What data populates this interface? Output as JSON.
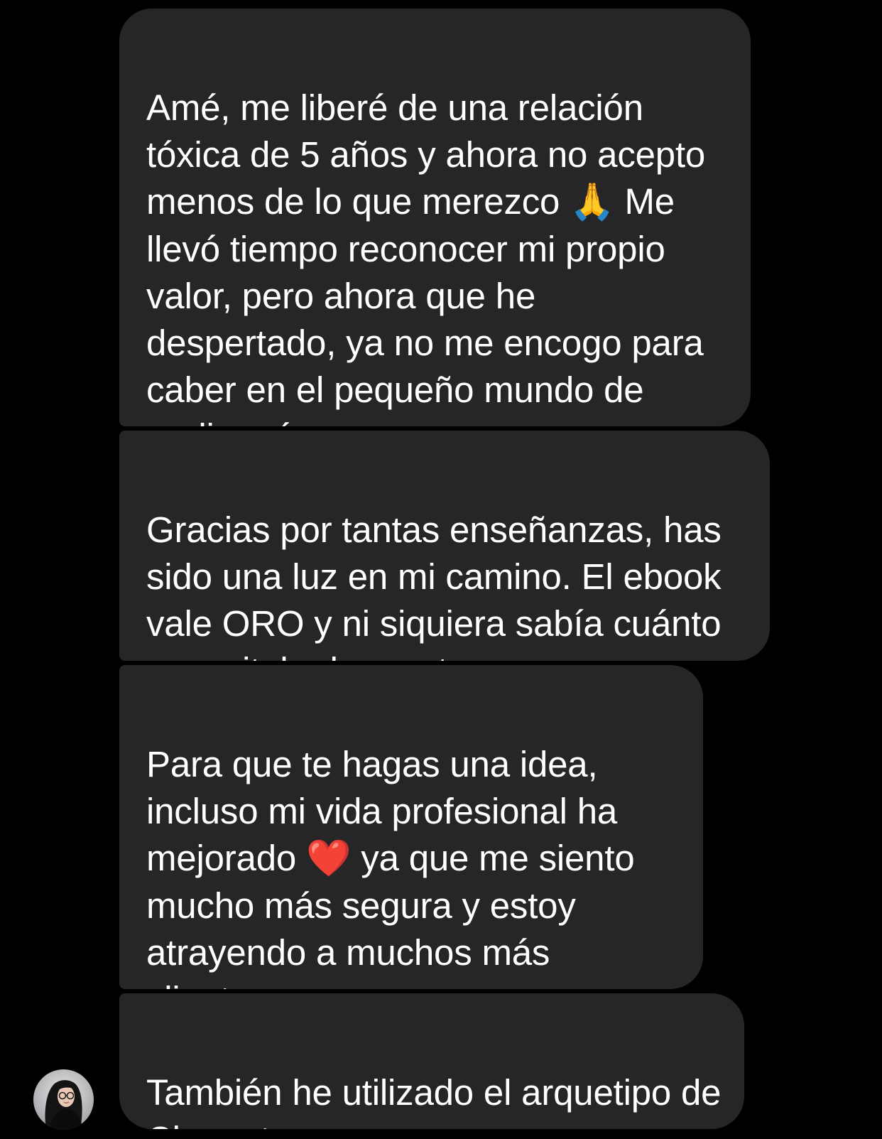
{
  "conversation": {
    "messages": [
      {
        "segments": [
          "Amé, me liberé de una relación tóxica de 5 años y ahora no acepto menos de lo que merezco ",
          "🙏",
          " Me llevó tiempo reconocer mi propio valor, pero ahora que he despertado, ya no me encogo para caber en el pequeño mundo de nadie más..."
        ]
      },
      {
        "text": "Gracias por tantas enseñanzas, has sido una luz en mi camino. El ebook vale ORO y ni siquiera sabía cuánto necesitaba leer esto."
      },
      {
        "segments": [
          "Para que te hagas una idea, incluso mi vida profesional ha mejorado ",
          "❤️",
          " ya que me siento mucho más segura y estoy atrayendo a muchos más clientes..."
        ]
      },
      {
        "text": "También he utilizado el arquetipo de Cleopatra."
      }
    ],
    "sender_avatar": {
      "icon": "user-avatar-photo"
    }
  },
  "theme": {
    "background": "#000000",
    "bubble_color": "#262628",
    "text_color": "#ffffff"
  }
}
